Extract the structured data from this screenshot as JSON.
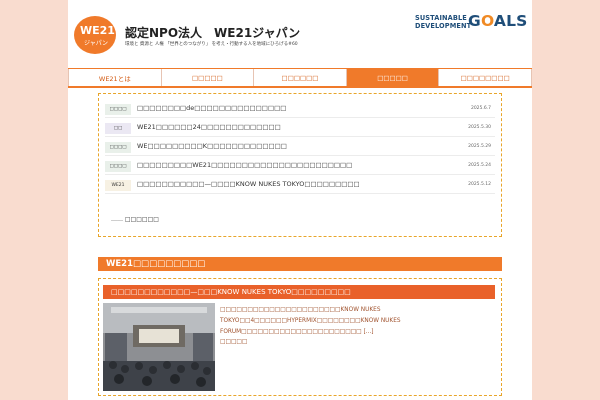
{
  "header": {
    "logo_text": "WE21",
    "logo_kana": "ジャパン",
    "org_title": "認定NPO法人　WE21ジャパン",
    "tagline": "環境と 資源と 人権 「世界とのつながり」 を考え・行動する人を地域にひろげる#60",
    "sdg_line1": "SUSTAINABLE",
    "sdg_line2": "DEVELOPMENT",
    "sdg_goals_g": "G",
    "sdg_goals_o": "O",
    "sdg_goals_als": "ALS"
  },
  "nav": {
    "items": [
      {
        "label": "WE21とは"
      },
      {
        "label": "□□□□□"
      },
      {
        "label": "□□□□□□"
      },
      {
        "label": "□□□□□"
      },
      {
        "label": "□□□□□□□□"
      }
    ]
  },
  "news": {
    "items": [
      {
        "badge": "□□□□",
        "title": "□□□□□□□□de□□□□□□□□□□□□□□□",
        "date": "2025.6.7"
      },
      {
        "badge": "□□",
        "title": "WE21□□□□□□24□□□□□□□□□□□□□",
        "date": "2025.5.30"
      },
      {
        "badge": "□□□□",
        "title": "WE□□□□□□□□□K□□□□□□□□□□□□□",
        "date": "2025.5.29"
      },
      {
        "badge": "□□□□",
        "title": "□□□□□□□□□WE21□□□□□□□□□□□□□□□□□□□□□□□",
        "date": "2025.5.24"
      },
      {
        "badge": "WE21",
        "title": "□□□□□□□□□□□—□□□□KNOW NUKES TOKYO□□□□□□□□□",
        "date": "2025.5.12"
      }
    ],
    "more": "…… □□□□□□"
  },
  "blog": {
    "heading": "WE21□□□□□□□□□",
    "post": {
      "title": "□□□□□□□□□□□□—□□□KNOW NUKES TOKYO□□□□□□□□□",
      "excerpt": "□□□□□□□□□□□□□□□□□□□□□□KNOW NUKES TOKYO□□4□□□□□□HYPERMIX□□□□□□□□KNOW NUKES FORUM□□□□□□□□□□□□□□□□□□□□□□ [...]",
      "more": "□□□□□"
    }
  },
  "colors": {
    "accent": "#f07a2a",
    "background": "#f9dccf",
    "dashed_border": "#e8a52a",
    "sdg_blue": "#1f4e79"
  }
}
